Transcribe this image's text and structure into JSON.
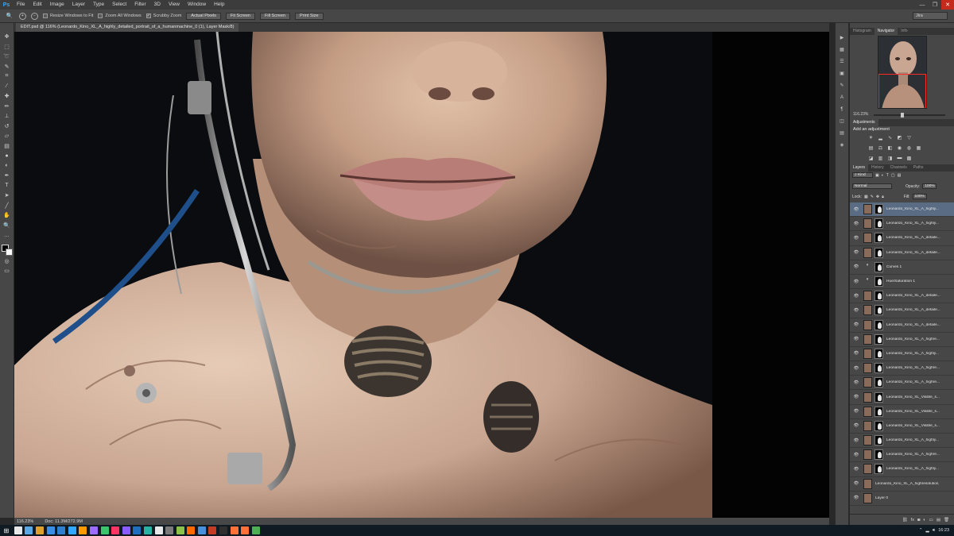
{
  "app": {
    "logo": "Ps",
    "brand_color": "#31a8ff"
  },
  "menu": [
    "File",
    "Edit",
    "Image",
    "Layer",
    "Type",
    "Select",
    "Filter",
    "3D",
    "View",
    "Window",
    "Help"
  ],
  "window_controls": {
    "minimize": "—",
    "maximize": "❐",
    "close": "✕"
  },
  "options": {
    "resize_windows": {
      "label": "Resize Windows to Fit",
      "checked": false
    },
    "zoom_all": {
      "label": "Zoom All Windows",
      "checked": false
    },
    "scrubby_zoom": {
      "label": "Scrubby Zoom",
      "checked": true
    },
    "buttons": [
      "Actual Pixels",
      "Fit Screen",
      "Fill Screen",
      "Print Size"
    ],
    "workspace": "Jira"
  },
  "document": {
    "tab_title": "EDIT.psd @ 116% (Leonardo_Kino_XL_A_highly_detailed_portrait_of_a_humanmachine_0 (1), Layer Mask/8)",
    "zoom": "116.23%",
    "doc_size": "Doc: 11.3M/272.9M"
  },
  "panels": {
    "top_tabs": [
      "Histogram",
      "Navigator",
      "Info"
    ],
    "active_top_tab": "Navigator",
    "navigator_zoom": "116.23%",
    "adjustments_tab": "Adjustments",
    "adjustments_title": "Add an adjustment",
    "layers_tabs": [
      "Layers",
      "History",
      "Channels",
      "Paths"
    ],
    "kind_label": "Kind",
    "blend_mode": "Normal",
    "opacity_label": "Opacity:",
    "opacity_value": "100%",
    "lock_label": "Lock:",
    "fill_label": "Fill:",
    "fill_value": "100%"
  },
  "layers": [
    {
      "name": "Leonardo_Kino_XL_A_highly...",
      "type": "mask",
      "selected": true
    },
    {
      "name": "Leonardo_Kino_XL_A_highly...",
      "type": "mask",
      "selected": false
    },
    {
      "name": "Leonardo_Kino_XL_A_detaile...",
      "type": "mask",
      "selected": false
    },
    {
      "name": "Leonardo_Kino_XL_A_detaile...",
      "type": "mask",
      "selected": false
    },
    {
      "name": "Curves 1",
      "type": "adjust",
      "selected": false
    },
    {
      "name": "Hue/Saturation 1",
      "type": "adjust",
      "selected": false
    },
    {
      "name": "Leonardo_Kino_XL_A_detaile...",
      "type": "mask",
      "selected": false
    },
    {
      "name": "Leonardo_Kino_XL_A_detaile...",
      "type": "mask",
      "selected": false
    },
    {
      "name": "Leonardo_Kino_XL_A_detaile...",
      "type": "mask",
      "selected": false
    },
    {
      "name": "Leonardo_Kino_XL_A_highre...",
      "type": "mask",
      "selected": false
    },
    {
      "name": "Leonardo_Kino_XL_A_highly...",
      "type": "mask",
      "selected": false
    },
    {
      "name": "Leonardo_Kino_XL_A_highre...",
      "type": "mask",
      "selected": false
    },
    {
      "name": "Leonardo_Kino_XL_A_highre...",
      "type": "mask",
      "selected": false
    },
    {
      "name": "Leonardo_Kino_XL_Visible_s...",
      "type": "mask",
      "selected": false
    },
    {
      "name": "Leonardo_Kino_XL_Visible_s...",
      "type": "mask",
      "selected": false
    },
    {
      "name": "Leonardo_Kino_XL_Visible_s...",
      "type": "mask",
      "selected": false
    },
    {
      "name": "Leonardo_Kino_XL_A_highly...",
      "type": "mask",
      "selected": false
    },
    {
      "name": "Leonardo_Kino_XL_A_highre...",
      "type": "mask",
      "selected": false
    },
    {
      "name": "Leonardo_Kino_XL_A_highly...",
      "type": "mask",
      "selected": false
    },
    {
      "name": "Leonardo_Kino_XL_A_highresolution_...",
      "type": "plain",
      "selected": false
    },
    {
      "name": "Layer 0",
      "type": "plain",
      "selected": false
    }
  ],
  "taskbar": {
    "time": "16:23",
    "icon_colors": [
      "#e8e8e8",
      "#5aa9e6",
      "#e0a030",
      "#3a8ee6",
      "#2f7fd0",
      "#31a8ff",
      "#ff9a00",
      "#9b6cff",
      "#3ac46b",
      "#ff3366",
      "#8a5cff",
      "#1e6fbf",
      "#2ab1a5",
      "#e8e8e8",
      "#7a7a7a",
      "#8bc34a",
      "#ff6a00",
      "#4a90d9",
      "#c23b22",
      "#2f2f2f",
      "#ff7139",
      "#ff7139",
      "#4caf50"
    ]
  }
}
